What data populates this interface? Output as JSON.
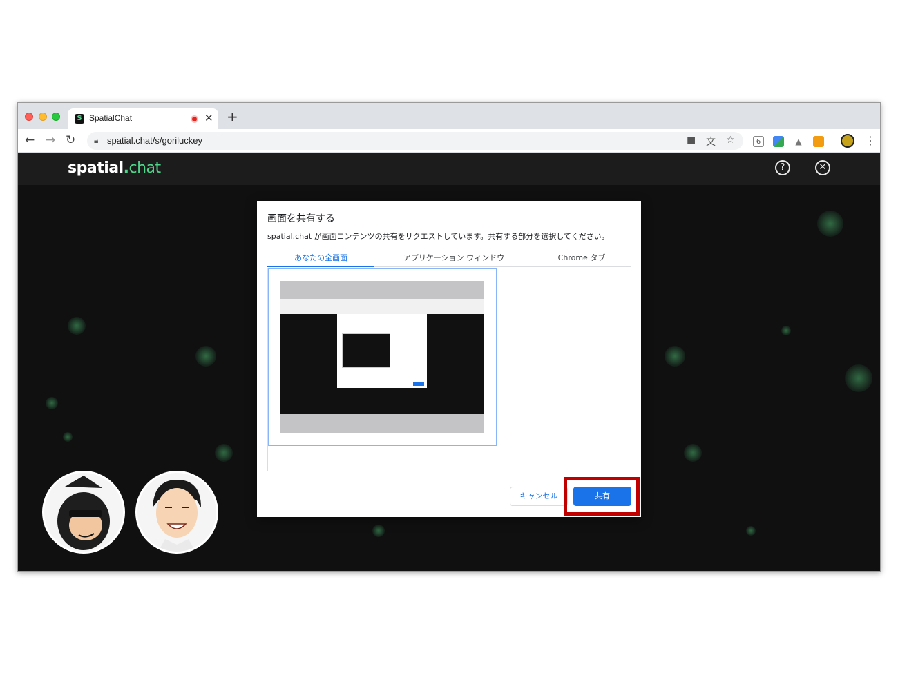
{
  "browser": {
    "tab_title": "SpatialChat",
    "tab_favicon_letter": "S",
    "url": "spatial.chat/s/goriluckey",
    "new_tab_symbol": "+",
    "extension_badge": "6"
  },
  "app": {
    "brand_main": "spatial",
    "brand_dot": ".",
    "brand_suffix": "chat",
    "help_symbol": "?",
    "close_symbol": "✕"
  },
  "dialog": {
    "title": "画面を共有する",
    "description": "spatial.chat が画面コンテンツの共有をリクエストしています。共有する部分を選択してください。",
    "tabs": [
      {
        "label": "あなたの全画面"
      },
      {
        "label": "アプリケーション ウィンドウ"
      },
      {
        "label": "Chrome タブ"
      }
    ],
    "cancel_label": "キャンセル",
    "share_label": "共有"
  },
  "colors": {
    "accent": "#1a73e8",
    "brand_green": "#4fd58a",
    "highlight_red": "#c00000",
    "page_bg": "#101010"
  },
  "icons": [
    "back-arrow-icon",
    "forward-arrow-icon",
    "reload-icon",
    "lock-icon",
    "camera-icon",
    "translate-icon",
    "star-icon",
    "help-icon",
    "close-icon",
    "more-icon"
  ]
}
